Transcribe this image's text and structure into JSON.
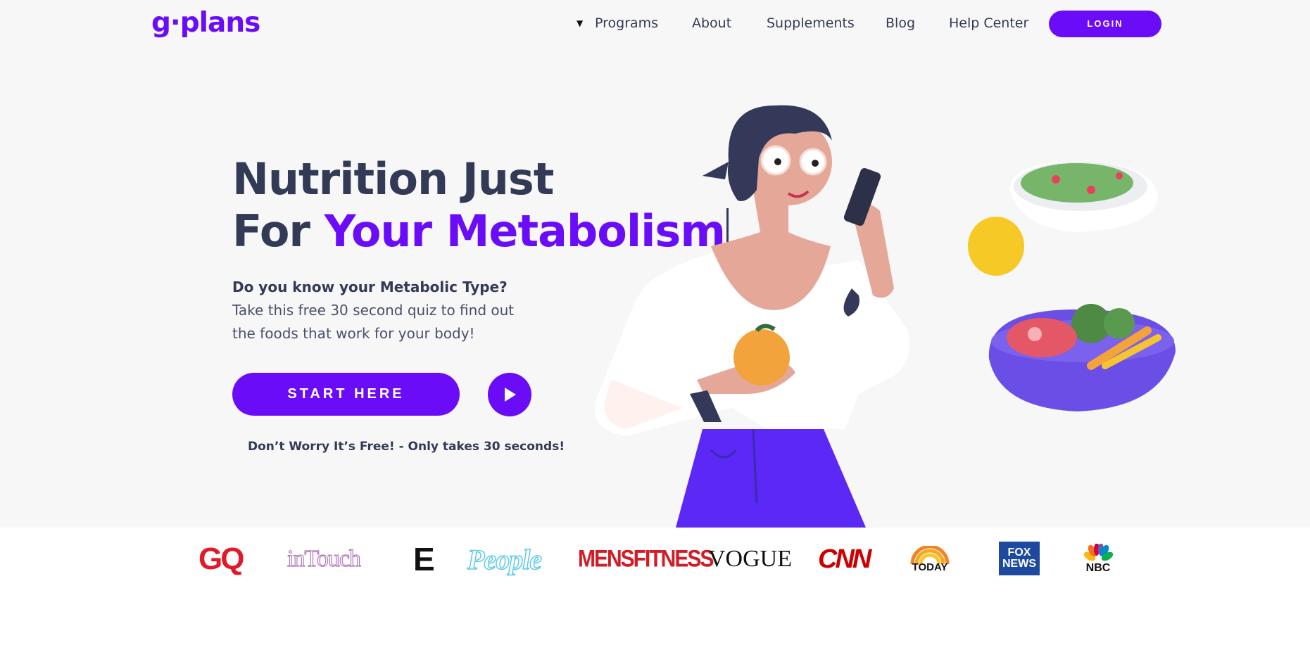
{
  "header": {
    "logo": "g·plans",
    "nav": [
      {
        "label": "Programs",
        "has_dropdown": true
      },
      {
        "label": "About"
      },
      {
        "label": "Supplements"
      },
      {
        "label": "Blog"
      },
      {
        "label": "Help Center"
      }
    ],
    "login_label": "LOGIN"
  },
  "hero": {
    "headline_line1": "Nutrition Just",
    "headline_line2_plain": "For ",
    "headline_line2_accent": "Your Metabolism",
    "subtext_bold": "Do you know your Metabolic Type?",
    "subtext_rest": " Take this free 30 second quiz to find out the foods that work for your body!",
    "start_label": "START HERE",
    "free_note": "Don’t Worry It’s Free! - Only takes 30 seconds!"
  },
  "press": {
    "gq": "GQ",
    "intouch": "inTouch",
    "e": "E",
    "people": "People",
    "mensfitness": "MENSFITNESS",
    "vogue": "VOGUE",
    "cnn": "CNN",
    "today": "TODAY",
    "fox_line1": "FOX",
    "fox_line2": "NEWS",
    "nbc": "NBC"
  },
  "colors": {
    "brand": "#6a0cf7",
    "text": "#333a55",
    "hero_bg": "#f7f7f7"
  }
}
